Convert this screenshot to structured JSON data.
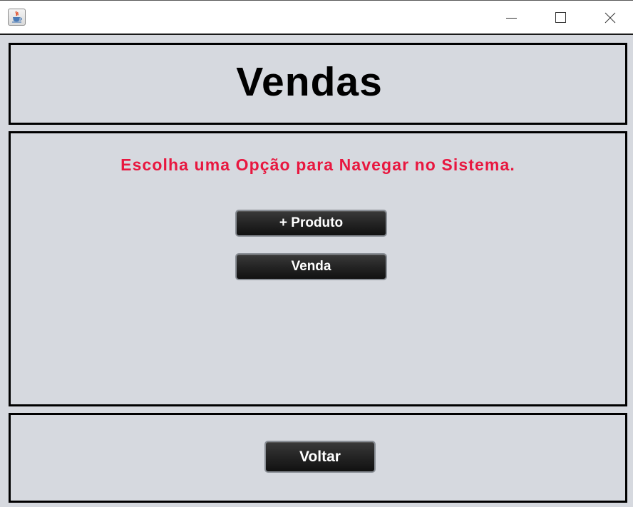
{
  "window": {
    "icon": "java-cup-icon",
    "controls": {
      "minimize": "minimize-icon",
      "maximize": "maximize-icon",
      "close": "close-icon"
    }
  },
  "header": {
    "title": "Vendas"
  },
  "main": {
    "subtitle": "Escolha uma Opção para Navegar no Sistema.",
    "buttons": {
      "produto_label": "+ Produto",
      "venda_label": "Venda"
    }
  },
  "footer": {
    "voltar_label": "Voltar"
  },
  "colors": {
    "panel_background": "#d6d9df",
    "subtitle_color": "#e8173f",
    "button_background": "#262626",
    "border": "#000000"
  }
}
